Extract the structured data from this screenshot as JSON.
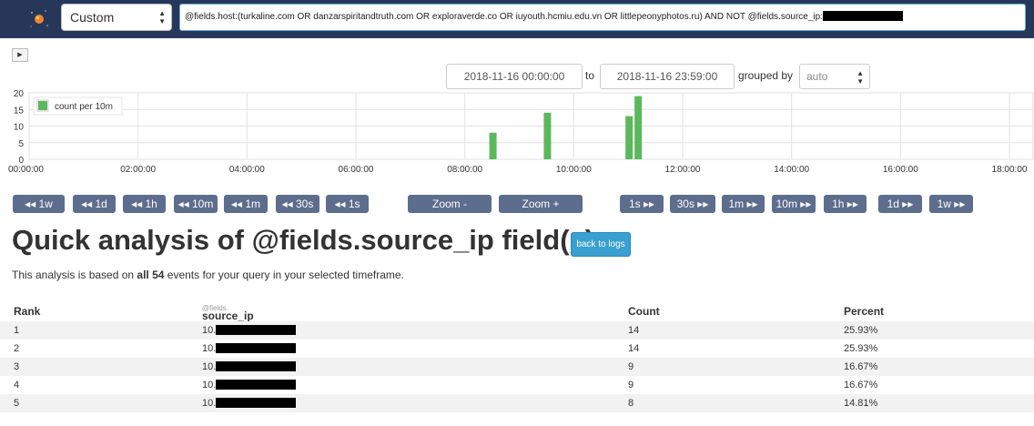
{
  "topbar": {
    "range_select_value": "Custom",
    "query_text": "@fields.host:(turkaline.com OR danzarspiritandtruth.com OR exploraverde.co OR iuyouth.hcmiu.edu.vn OR littlepeonyphotos.ru) AND NOT @fields.source_ip:"
  },
  "timeframe": {
    "from": "2018-11-16 00:00:00",
    "to_label": "to",
    "to": "2018-11-16 23:59:00",
    "grouped_by_label": "grouped by",
    "grouped_by_value": "auto"
  },
  "chart_data": {
    "type": "bar",
    "x": [
      "08:30:00",
      "09:30:00",
      "11:00:00",
      "11:10:00"
    ],
    "values": [
      8,
      14,
      13,
      19
    ],
    "series": [
      {
        "name": "count per 10m",
        "values": [
          8,
          14,
          13,
          19
        ]
      }
    ],
    "x_ticks": [
      "00:00:00",
      "02:00:00",
      "04:00:00",
      "06:00:00",
      "08:00:00",
      "10:00:00",
      "12:00:00",
      "14:00:00",
      "16:00:00",
      "18:00:00"
    ],
    "y_ticks": [
      "0",
      "5",
      "10",
      "15",
      "20"
    ],
    "ylim": [
      0,
      20
    ],
    "legend_label": "count per 10m",
    "bar_color": "#5cb85c",
    "grid": true,
    "legend_position": "top-left"
  },
  "nav": {
    "back": [
      "◂◂ 1w",
      "◂◂ 1d",
      "◂◂ 1h",
      "◂◂ 10m",
      "◂◂ 1m",
      "◂◂ 30s",
      "◂◂ 1s"
    ],
    "zoom_out": "Zoom -",
    "zoom_in": "Zoom +",
    "forward": [
      "1s ▸▸",
      "30s ▸▸",
      "1m ▸▸",
      "10m ▸▸",
      "1h ▸▸",
      "1d ▸▸",
      "1w ▸▸"
    ]
  },
  "analysis": {
    "title": "Quick analysis of @fields.source_ip field(s)",
    "back_button": "back to logs",
    "desc_prefix": "This analysis is based on ",
    "desc_all": "all 54",
    "desc_suffix": " events for your query in your selected timeframe."
  },
  "table": {
    "headers": {
      "rank": "Rank",
      "field_prefix": "@fields.",
      "field": "source_ip",
      "count": "Count",
      "percent": "Percent"
    },
    "rows": [
      {
        "rank": "1",
        "ip": "10.",
        "count": "14",
        "percent": "25.93%"
      },
      {
        "rank": "2",
        "ip": "10.",
        "count": "14",
        "percent": "25.93%"
      },
      {
        "rank": "3",
        "ip": "10.",
        "count": "9",
        "percent": "16.67%"
      },
      {
        "rank": "4",
        "ip": "10.",
        "count": "9",
        "percent": "16.67%"
      },
      {
        "rank": "5",
        "ip": "10.",
        "count": "8",
        "percent": "14.81%"
      }
    ]
  },
  "colors": {
    "topbar": "#26375a",
    "nav_button": "#5d6d8d",
    "back_button": "#3aa0cf",
    "bar": "#5cb85c"
  }
}
